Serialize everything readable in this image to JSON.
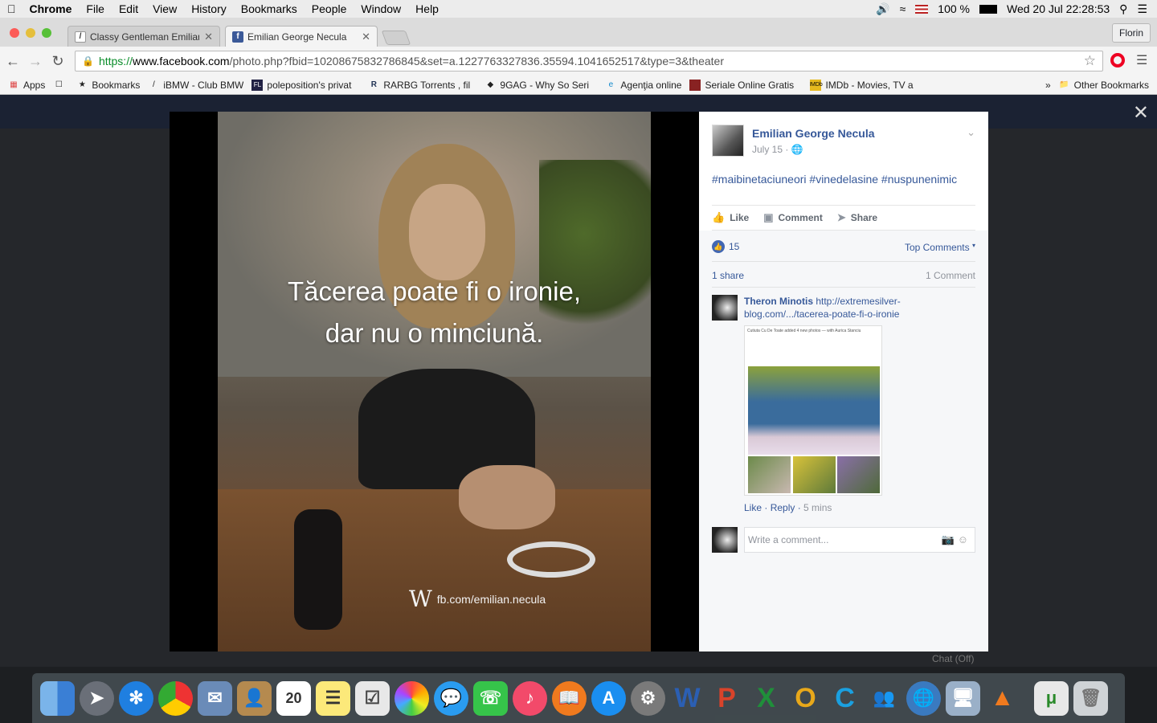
{
  "menubar": {
    "app": "Chrome",
    "items": [
      "File",
      "Edit",
      "View",
      "History",
      "Bookmarks",
      "People",
      "Window",
      "Help"
    ],
    "battery": "100 %",
    "datetime": "Wed 20 Jul  22:28:53"
  },
  "tabs": [
    {
      "title": "Classy Gentleman Emilianu"
    },
    {
      "title": "Emilian George Necula"
    }
  ],
  "profile": "Florin",
  "url": {
    "prefix": "https://",
    "host": "www.facebook.com",
    "path": "/photo.php?fbid=10208675832786845&set=a.1227763327836.35594.1041652517&type=3&theater"
  },
  "bookmarks": [
    "Apps",
    "Bookmarks",
    "iBMW - Club BMW",
    "poleposition's privat",
    "RARBG Torrents , fil",
    "9GAG - Why So Seri",
    "Agenţia online",
    "Seriale Online Gratis",
    "IMDb - Movies, TV a",
    "Other Bookmarks"
  ],
  "photo": {
    "quote_line1": "Tăcerea poate fi o ironie,",
    "quote_line2": "dar nu o minciună.",
    "watermark": "fb.com/emilian.necula"
  },
  "post": {
    "author": "Emilian George Necula",
    "date": "July 15 · ",
    "hashtags": "#maibinetaciuneori #vinedelasine #nuspunenimic",
    "like": "Like",
    "comment": "Comment",
    "share": "Share",
    "reactions": "15",
    "top_comments": "Top Comments",
    "shares": "1 share",
    "comments_count": "1 Comment"
  },
  "comment": {
    "author": "Theron Minotis",
    "link": "http://extremesilver-blog.com/.../tacerea-poate-fi-o-ironie",
    "like": "Like",
    "reply": "Reply",
    "time": "5 mins",
    "preview_header": "Cutiuta Cu De Toate added 4 new photos — with Aurica Stanciu"
  },
  "write_placeholder": "Write a comment...",
  "chat": "Chat (Off)"
}
